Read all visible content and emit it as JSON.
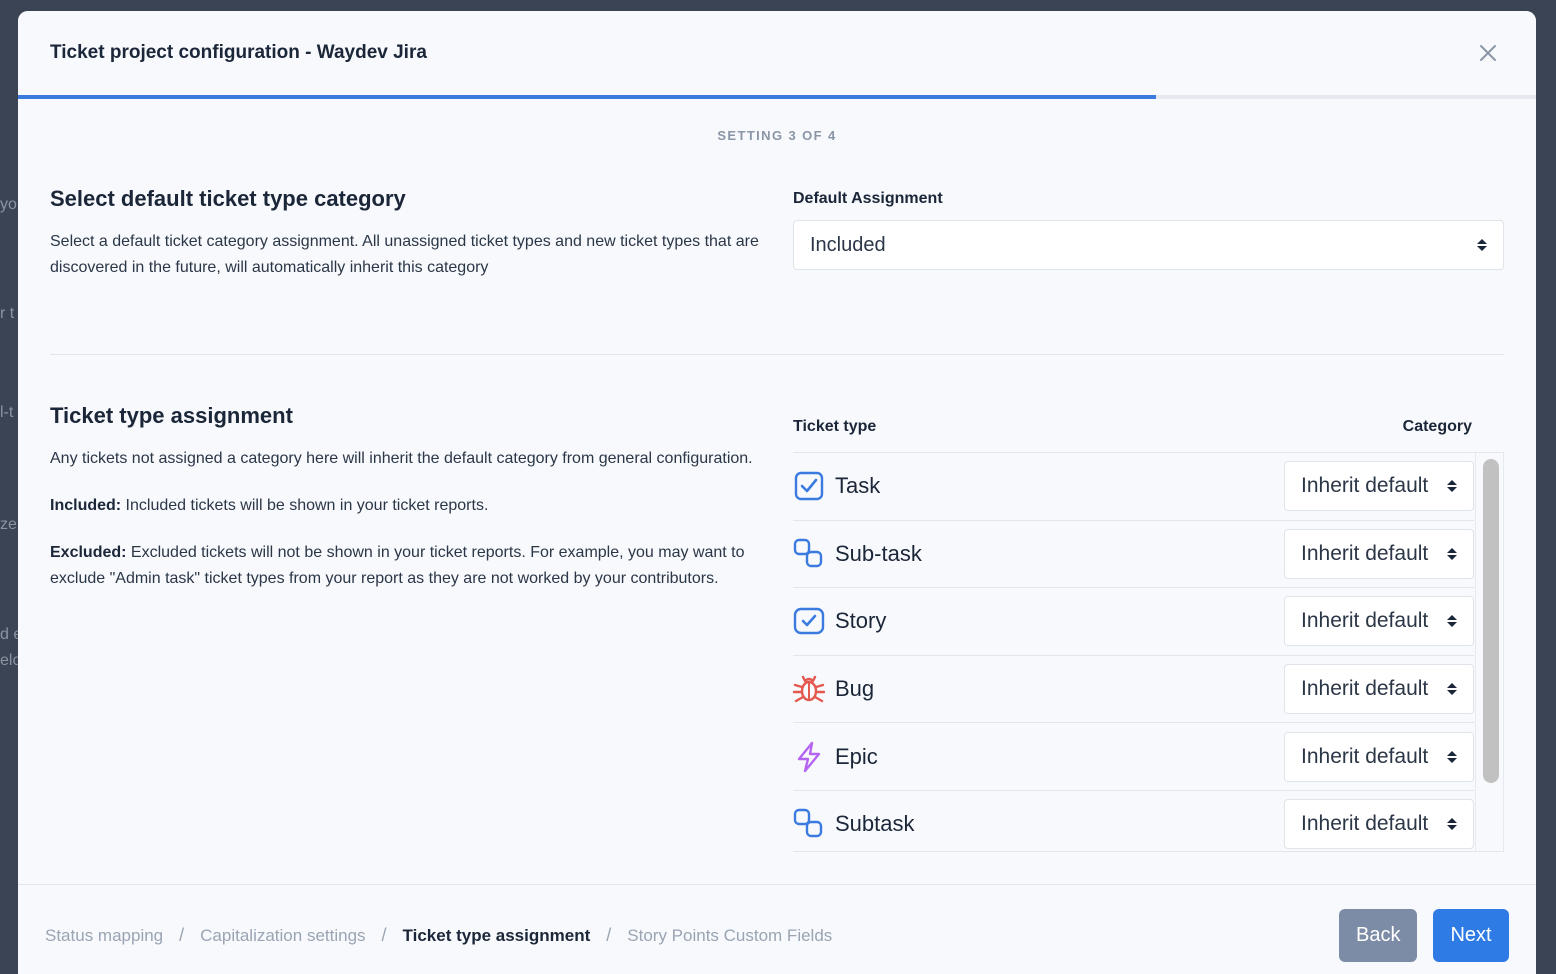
{
  "modal": {
    "title": "Ticket project configuration - Waydev Jira",
    "step_indicator": "SETTING 3 OF 4",
    "progress": 0.75
  },
  "default_section": {
    "title": "Select default ticket type category",
    "description": "Select a default ticket category assignment. All unassigned ticket types and new ticket types that are discovered in the future, will automatically inherit this category",
    "field_label": "Default Assignment",
    "selected_value": "Included"
  },
  "assignment_section": {
    "title": "Ticket type assignment",
    "intro": "Any tickets not assigned a category here will inherit the default category from general configuration.",
    "included_label": "Included:",
    "included_text": " Included tickets will be shown in your ticket reports.",
    "excluded_label": "Excluded:",
    "excluded_text": " Excluded tickets will not be shown in your ticket reports. For example, you may want to exclude \"Admin task\" ticket types from your report as they are not worked by your contributors.",
    "table": {
      "col_type": "Ticket type",
      "col_category": "Category",
      "rows": [
        {
          "name": "Task",
          "icon": "task-checkbox-icon",
          "category": "Inherit default"
        },
        {
          "name": "Sub-task",
          "icon": "subtask-icon",
          "category": "Inherit default"
        },
        {
          "name": "Story",
          "icon": "story-checkbox-icon",
          "category": "Inherit default"
        },
        {
          "name": "Bug",
          "icon": "bug-icon",
          "category": "Inherit default"
        },
        {
          "name": "Epic",
          "icon": "lightning-icon",
          "category": "Inherit default"
        },
        {
          "name": "Subtask",
          "icon": "subtask-icon",
          "category": "Inherit default"
        }
      ]
    }
  },
  "footer": {
    "crumbs": [
      "Status mapping",
      "Capitalization settings",
      "Ticket type assignment",
      "Story Points Custom Fields"
    ],
    "separator": "/",
    "back_label": "Back",
    "next_label": "Next"
  },
  "colors": {
    "accent": "#2f7be6",
    "back_button": "#7d8ca6",
    "bug_icon": "#e5584f",
    "epic_icon": "#b565f2",
    "task_icon": "#3b7be0"
  }
}
